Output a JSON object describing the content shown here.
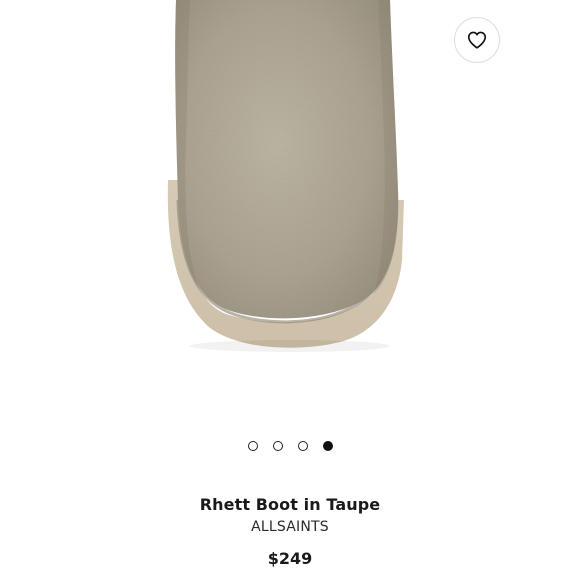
{
  "product": {
    "title": "Rhett Boot in Taupe",
    "brand": "ALLSAINTS",
    "price": "$249"
  },
  "image": {
    "subject": "boot-photo",
    "colors": {
      "suede": "#a9a08c",
      "sole": "#d8cdbb",
      "background": "#ffffff"
    }
  },
  "wishlist": {
    "icon": "heart-icon"
  },
  "carousel": {
    "total": 4,
    "active_index": 3
  }
}
